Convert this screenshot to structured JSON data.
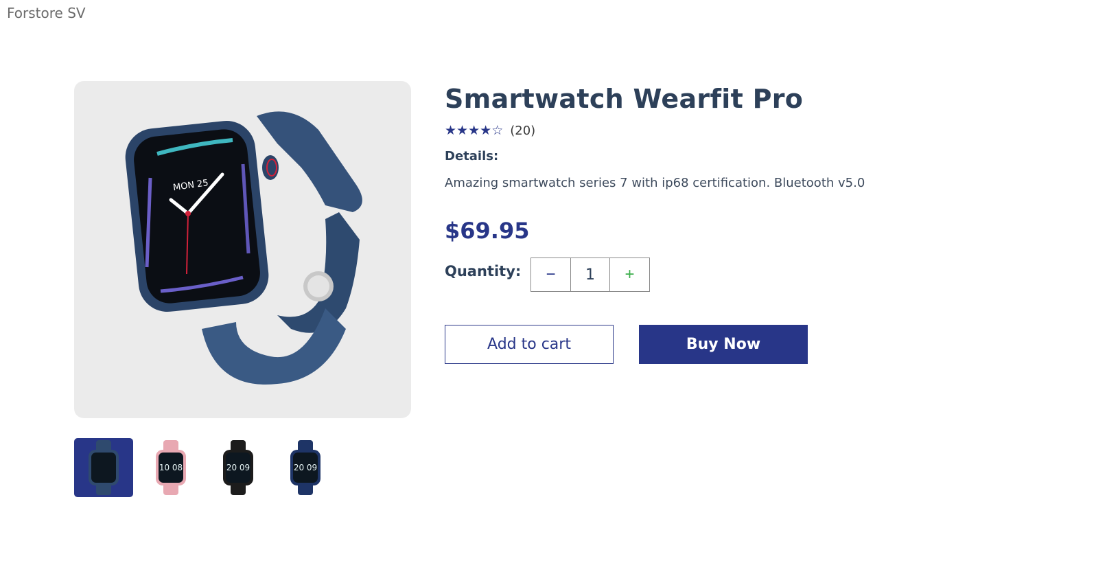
{
  "site": {
    "title": "Forstore SV"
  },
  "product": {
    "name": "Smartwatch Wearfit Pro",
    "rating": 4,
    "rating_max": 5,
    "review_count": "(20)",
    "details_label": "Details:",
    "description": "Amazing smartwatch series 7 with ip68 certification. Bluetooth v5.0",
    "price": "$69.95",
    "quantity_label": "Quantity:",
    "quantity": "1",
    "minus_symbol": "−",
    "plus_symbol": "+",
    "add_to_cart_label": "Add to cart",
    "buy_now_label": "Buy Now",
    "main_screen_text": "MON 25",
    "thumbnails": [
      {
        "name": "navy-watch-side",
        "color": "#2f4a6e",
        "active": true,
        "screen_text": ""
      },
      {
        "name": "pink-watch",
        "color": "#e8a8b2",
        "active": false,
        "screen_text": "10 08"
      },
      {
        "name": "black-watch",
        "color": "#1c1c1c",
        "active": false,
        "screen_text": "20 09"
      },
      {
        "name": "navy-watch-front",
        "color": "#1e3466",
        "active": false,
        "screen_text": "20 09"
      }
    ]
  },
  "colors": {
    "brand": "#283688",
    "text": "#2d4059",
    "plus": "#3cae4c",
    "image_bg": "#ebebeb"
  }
}
